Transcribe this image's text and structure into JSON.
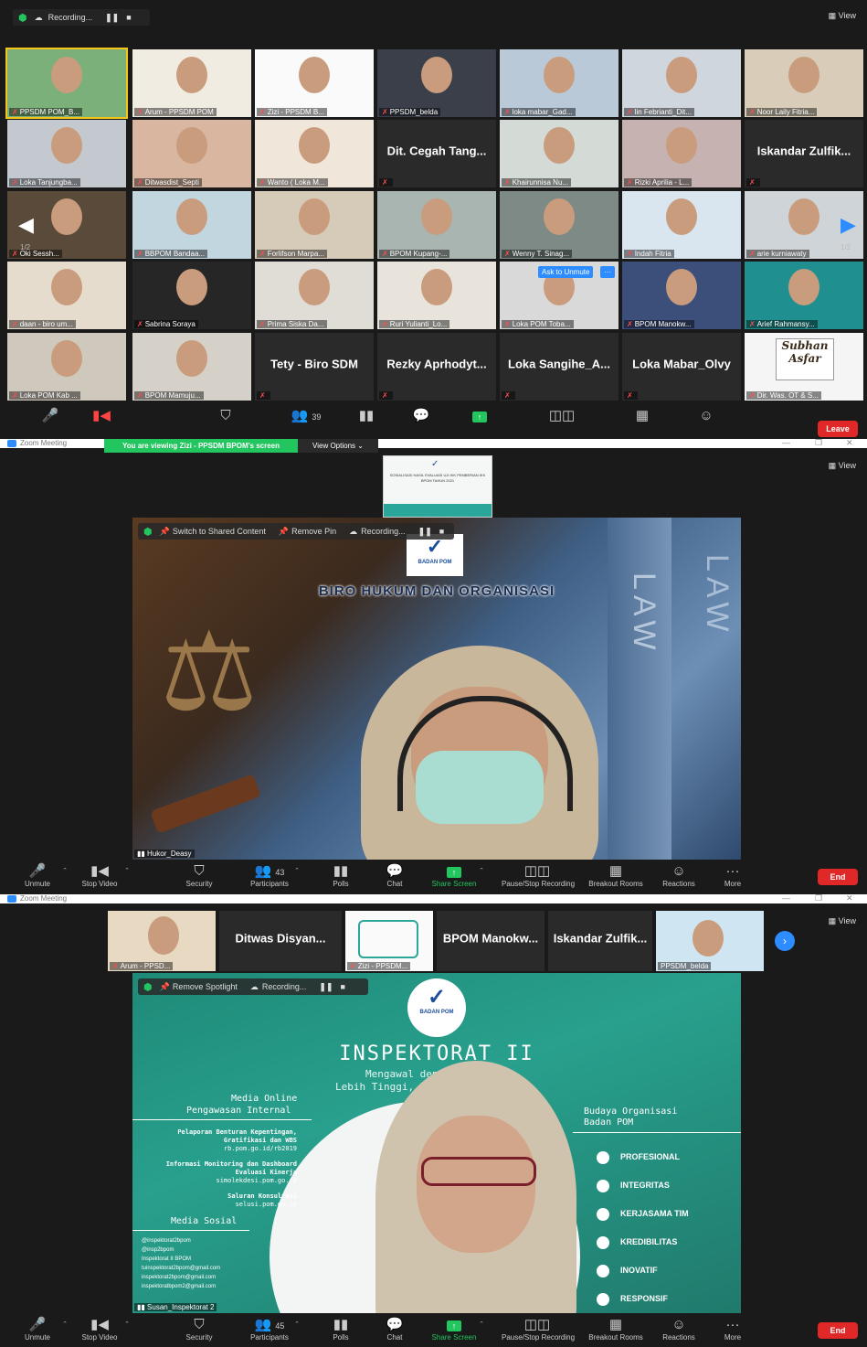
{
  "colors": {
    "accent": "#2d8cff",
    "end": "#e02828",
    "green": "#22c55e",
    "bg": "#1a1a1a"
  },
  "panel1": {
    "recording": "Recording...",
    "view": "View",
    "page_left": "1/2",
    "page_right": "1/2",
    "tiles": [
      "PPSDM POM_B...",
      "Arum - PPSDM POM",
      "Zizi - PPSDM B...",
      "PPSDM_belda",
      "loka mabar_Gad...",
      "lin Febrianti_Dit...",
      "Noor Laily Fitria...",
      "Loka Tanjungba...",
      "Ditwasdist_Septi",
      "Wanto ( Loka M...",
      "Dit. Cegah Tang...",
      "Khairunnisa Nu...",
      "Rizki Aprilia - L...",
      "Iskandar Zulfik...",
      "Oki Sessh...",
      "BBPOM Bandaa...",
      "Forlifson Marpa...",
      "BPOM Kupang-...",
      "Wenny T. Sinag...",
      "Indah Fitria",
      "arie kurniawaty",
      "daan - biro um...",
      "Sabrina Soraya",
      "Prima Siska Da...",
      "Ruri Yulianti_Lo...",
      "Loka POM Toba...",
      "BPOM Manokw...",
      "Arief Rahmansy...",
      "Loka POM Kab ...",
      "BPOM Mamuju...",
      "Tety - Biro SDM",
      "Rezky Aprhodyt...",
      "Loka Sangihe_A...",
      "Loka Mabar_Olvy",
      "Dir. Was. OT & S..."
    ],
    "ask_unmute": "Ask to Unmute",
    "subhan": "Subhan Asfar",
    "participants_count": "39",
    "leave": "Leave"
  },
  "panel2": {
    "title": "Zoom Meeting",
    "viewing": "You are viewing Zizi - PPSDM BPOM's screen",
    "view_options": "View Options",
    "view": "View",
    "slide_title": "SOSIALISASI HASIL EVALUASI UJI IKK PEMBERIAN IKK BPOM TAHUN 2021",
    "switch": "Switch to Shared Content",
    "remove_pin": "Remove Pin",
    "recording": "Recording...",
    "badan_pom": "BADAN POM",
    "biro": "BIRO HUKUM DAN ORGANISASI",
    "law1": "LAW",
    "law2": "LAW",
    "speaker": "Hukor_Deasy",
    "participants_count": "43",
    "toolbar": [
      "Unmute",
      "Stop Video",
      "Security",
      "Participants",
      "Polls",
      "Chat",
      "Share Screen",
      "Pause/Stop Recording",
      "Breakout Rooms",
      "Reactions",
      "More"
    ],
    "end": "End"
  },
  "panel3": {
    "title": "Zoom Meeting",
    "view": "View",
    "strip": [
      "Arum - PPSD...",
      "Ditwas Disyan...",
      "Zizi - PPSDM...",
      "BPOM Manokw...",
      "Iskandar Zulfik...",
      "PPSDM_belda"
    ],
    "remove_spotlight": "Remove Spotlight",
    "recording": "Recording...",
    "badan_pom": "BADAN POM",
    "inspektorat": "INSPEKTORAT II",
    "tagline1": "Mengawal deng",
    "tagline2": "Lebih Tinggi, Lebih",
    "media_online": "Media Online",
    "pengawasan": "Pengawasan Internal",
    "left_items": [
      "Pelaporan Benturan Kepentingan, Gratifikasi dan WBS",
      "rb.pom.go.id/rb2019",
      "Informasi Monitoring dan Dashboard Evaluasi Kinerja",
      "simolekdesi.pom.go.id",
      "Saluran Konsultasi",
      "selusi.pom.go.id"
    ],
    "media_sosial": "Media Sosial",
    "socials": [
      "@inspektorat2bpom",
      "@insp2bpom",
      "Inspektorat II BPOM",
      "tuinspektorat2bpom@gmail.com",
      "inspektorat2bpom@gmail.com",
      "inspektoratbpom2@gmail.com"
    ],
    "budaya1": "Budaya Organisasi",
    "budaya2": "Badan POM",
    "values": [
      "PROFESIONAL",
      "INTEGRITAS",
      "KERJASAMA TIM",
      "KREDIBILITAS",
      "INOVATIF",
      "RESPONSIF"
    ],
    "speaker": "Susan_Inspektorat 2",
    "participants_count": "45",
    "toolbar": [
      "Unmute",
      "Stop Video",
      "Security",
      "Participants",
      "Polls",
      "Chat",
      "Share Screen",
      "Pause/Stop Recording",
      "Breakout Rooms",
      "Reactions",
      "More"
    ],
    "end": "End"
  }
}
